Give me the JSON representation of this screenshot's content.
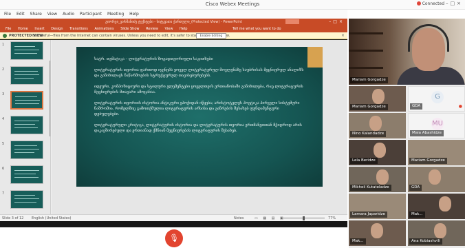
{
  "window": {
    "title": "Cisco Webex Meetings",
    "connection": "Connected",
    "controls": "–□×"
  },
  "menu": [
    "File",
    "Edit",
    "Share",
    "View",
    "Audio",
    "Participant",
    "Meeting",
    "Help"
  ],
  "powerpoint": {
    "title": "გიორგი_ვარშანიძე ტექსტები - სიტყვათა ქართული_(Protected View) - PowerPoint",
    "window_controls": "–□×",
    "ribbon_tabs": [
      "File",
      "Home",
      "Insert",
      "Design",
      "Transitions",
      "Animations",
      "Slide Show",
      "Review",
      "View",
      "Help"
    ],
    "tell_me": "Tell me what you want to do",
    "protected_view": {
      "label": "PROTECTED VIEW",
      "message": "Be careful—files from the Internet can contain viruses. Unless you need to edit, it's safer to stay in Protected View.",
      "button": "Enable Editing"
    },
    "thumbnail_numbers": [
      "1",
      "2",
      "3",
      "4",
      "5",
      "6",
      "7"
    ],
    "slide": {
      "paragraphs": [
        "სატრ. თემატიკა – ლიტერატურის ზოგადთეორიული საკითხები",
        "ლიტერატურის თეორია ფართოდ იყენებს ყოველ ლიტერატურულ მოვლენაზე საუბრისას მეცნიერულ ანალიზს და განიხილავს ნაწარმოების სტრუქტურულ თავისებურებებს.",
        "იდეური, კომპოზიციური და სტილური ელემენტები ყოველთვის ერთიანობაში განიხილება, რაც ლიტერატურის მეცნიერების მთავარი ამოცანაა.",
        "ლიტერატურის თეორიის ისტორია ანტიკური ეპოქიდან იწყება; არისტოტელეს პოეტიკა პირველი სისტემური ნაშრომია, რომელშიც გამოთქმულია ლიტერატურის არსისა და ჟანრების შესახებ ფუნდამენტური დებულებები.",
        "ლიტერატურული კრიტიკა, ლიტერატურის ისტორია და ლიტერატურის თეორია ერთმანეთთან მჭიდროდ არის დაკავშირებული და ერთიანად ქმნიან მეცნიერებას ლიტერატურის შესახებ."
      ]
    },
    "status": {
      "slide": "Slide 3 of 12",
      "language": "English (United States)",
      "notes": "Notes",
      "view_icons": "▭ ▦ ▤ ▣",
      "zoom": "77%"
    }
  },
  "participants": {
    "main_speaker": "Mariam Gorgadze",
    "tiles": [
      {
        "name": "Mariam Gorgadze",
        "type": "video"
      },
      {
        "name": "GDA",
        "type": "avatar",
        "initials": "G"
      },
      {
        "name": "Nino Kalandadze",
        "type": "video"
      },
      {
        "name": "Maia Abashidze",
        "type": "avatar",
        "initials": "MU"
      },
      {
        "name": "Lela Beridze",
        "type": "video"
      },
      {
        "name": "Mariam Gorgadze",
        "type": "video"
      },
      {
        "name": "Mikheil Kutateladze",
        "type": "video"
      },
      {
        "name": "GDA",
        "type": "video"
      },
      {
        "name": "Lamara Japaridze",
        "type": "video"
      },
      {
        "name": "Mak...",
        "type": "video"
      },
      {
        "name": "Ana Kobiashvili",
        "type": "video"
      }
    ]
  },
  "controls": {
    "mute_icon": "🎙"
  }
}
